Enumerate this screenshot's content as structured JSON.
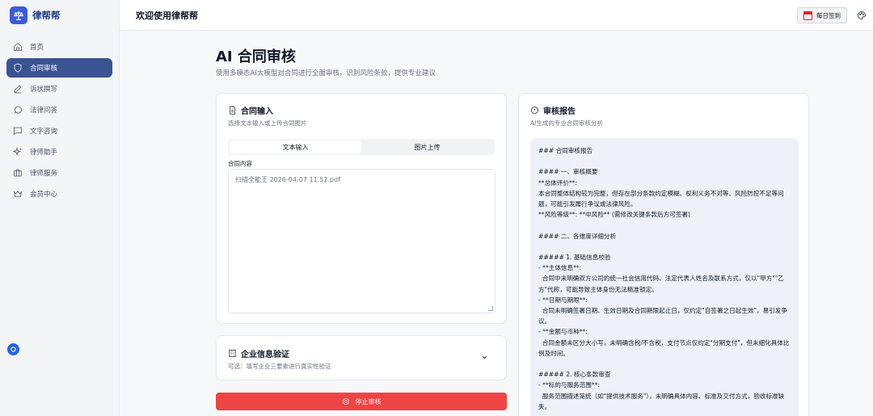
{
  "brand": {
    "name": "律帮帮"
  },
  "header": {
    "welcome": "欢迎使用律帮帮",
    "checkin_label": "每日签到"
  },
  "sidebar": {
    "items": [
      {
        "label": "首页",
        "icon": "home-icon"
      },
      {
        "label": "合同审核",
        "icon": "shield-icon",
        "active": true
      },
      {
        "label": "诉状撰写",
        "icon": "edit-icon"
      },
      {
        "label": "法律问答",
        "icon": "chat-bubble-icon"
      },
      {
        "label": "文字咨询",
        "icon": "message-square-icon"
      },
      {
        "label": "律师助手",
        "icon": "sparkles-icon"
      },
      {
        "label": "律师服务",
        "icon": "briefcase-icon"
      },
      {
        "label": "会员中心",
        "icon": "crown-icon"
      }
    ]
  },
  "page": {
    "title": "AI 合同审核",
    "subtitle": "使用多模态AI大模型对合同进行全面审核，识别风险条款，提供专业建议"
  },
  "input_card": {
    "title": "合同输入",
    "desc": "选择文本输入或上传合同图片",
    "tabs": [
      {
        "label": "文本输入",
        "active": true
      },
      {
        "label": "图片上传",
        "active": false
      }
    ],
    "field_label": "合同内容",
    "field_value": "扫描全能王 2026-04-07 11.52.pdf"
  },
  "verify_card": {
    "title": "企业信息验证",
    "desc": "可选：填写企业三要素进行真实性验证"
  },
  "stop_button": {
    "label": "停止审核"
  },
  "report_card": {
    "title": "审核报告",
    "desc": "AI生成的专业合同审核分析",
    "lines": [
      "### 合同审核报告",
      "",
      "#### 一、审核概要",
      "**总体评价**:",
      "本合同整体结构较为完整，但存在部分条款约定模糊、权利义务不对等、风险防控不足等问题，可能引发履行争议或法律风险。",
      "**风险等级**: **中风险** (需修改关键条款后方可签署)",
      "",
      "#### 二、各维度详细分析",
      "",
      "##### 1. 基础信息校验",
      "- **主体信息**:",
      "  合同中未明确双方公司的统一社会信用代码、法定代表人姓名及联系方式，仅以\"甲方\"\"乙方\"代称，可能导致主体身份无法精准锁定。",
      "- **日期与期限**:",
      "  合同未明确签署日期、生效日期及合同期限起止日，仅约定\"自签署之日起生效\"，易引发争议。",
      "- **金额与币种**:",
      "  合同金额未区分大小写，未明确含税/不含税，支付节点仅约定\"分期支付\"，但未细化具体比例及时间。",
      "",
      "##### 2. 核心条款审查",
      "- **标的与服务范围**:",
      "  服务范围描述笼统（如\"提供技术服务\"），未明确具体内容、标准及交付方式，验收标准缺失。"
    ]
  },
  "colors": {
    "sidebar_active": "#3b5393",
    "stop_button": "#ef4444",
    "report_bg": "#eef2f8"
  }
}
